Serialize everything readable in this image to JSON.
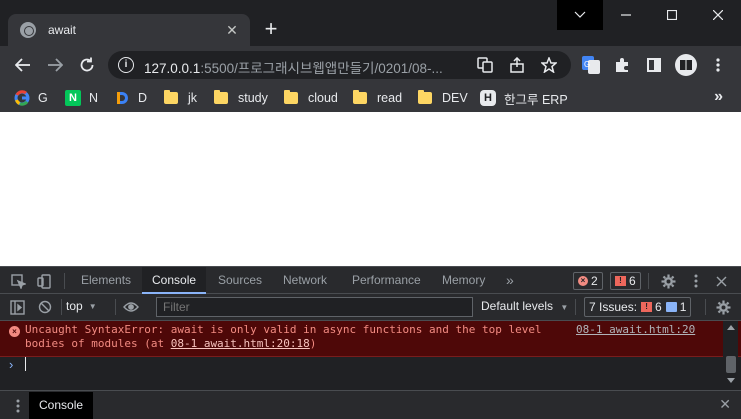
{
  "browser": {
    "tab": {
      "title": "await",
      "close_glyph": "✕"
    },
    "new_tab_glyph": "+",
    "omnibox": {
      "host": "127.0.0.1",
      "rest": ":5500/프로그래시브웹앱만들기/0201/08-..."
    },
    "bookmarks": [
      {
        "label": "G",
        "icon": "google-icon"
      },
      {
        "label": "N",
        "icon": "naver-icon"
      },
      {
        "label": "D",
        "icon": "d-logo-icon"
      },
      {
        "label": "jk",
        "icon": "folder-icon"
      },
      {
        "label": "study",
        "icon": "folder-icon"
      },
      {
        "label": "cloud",
        "icon": "folder-icon"
      },
      {
        "label": "read",
        "icon": "folder-icon"
      },
      {
        "label": "DEV",
        "icon": "folder-icon"
      },
      {
        "label": "한그루 ERP",
        "icon": "h-logo-icon"
      }
    ],
    "bookmarks_more": "»"
  },
  "devtools": {
    "tabs": [
      "Elements",
      "Console",
      "Sources",
      "Network",
      "Performance",
      "Memory"
    ],
    "active_tab": "Console",
    "more_tabs": "»",
    "error_count": "2",
    "warning_count": "6",
    "toolbar": {
      "context": "top",
      "filter_placeholder": "Filter",
      "levels": "Default levels",
      "issues_label": "7 Issues:",
      "issues_errors": "6",
      "issues_info": "1"
    },
    "message": {
      "line1": "Uncaught SyntaxError: await is only valid in async functions and the top level",
      "line2_prefix": "bodies of modules (at ",
      "line2_link": "08-1 await.html:20:18",
      "line2_suffix": ")",
      "source": "08-1 await.html:20"
    },
    "prompt": "›",
    "drawer_tab": "Console",
    "drawer_close": "✕"
  },
  "colors": {
    "accent": "#8ab4f8",
    "error_bg": "#4e0808",
    "error_text": "#f28b82",
    "folder": "#fdd663"
  }
}
